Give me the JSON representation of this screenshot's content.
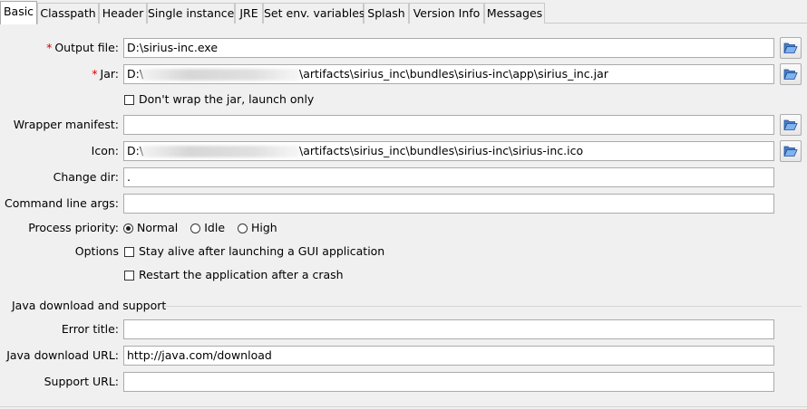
{
  "tabs": [
    {
      "label": "Basic"
    },
    {
      "label": "Classpath"
    },
    {
      "label": "Header"
    },
    {
      "label": "Single instance"
    },
    {
      "label": "JRE"
    },
    {
      "label": "Set env. variables"
    },
    {
      "label": "Splash"
    },
    {
      "label": "Version Info"
    },
    {
      "label": "Messages"
    }
  ],
  "form": {
    "output_file": {
      "label": "Output file:",
      "required_mark": "*",
      "value": "D:\\sirius-inc.exe"
    },
    "jar": {
      "label": "Jar:",
      "required_mark": "*",
      "value_prefix": "D:\\",
      "value_suffix": "\\artifacts\\sirius_inc\\bundles\\sirius-inc\\app\\sirius_inc.jar"
    },
    "dont_wrap": {
      "label": "Don't wrap the jar, launch only",
      "checked": false
    },
    "wrapper_manifest": {
      "label": "Wrapper manifest:",
      "value": ""
    },
    "icon": {
      "label": "Icon:",
      "value_prefix": "D:\\",
      "value_suffix": "\\artifacts\\sirius_inc\\bundles\\sirius-inc\\sirius-inc.ico"
    },
    "change_dir": {
      "label": "Change dir:",
      "value": "."
    },
    "command_line_args": {
      "label": "Command line args:",
      "value": ""
    },
    "process_priority": {
      "label": "Process priority:",
      "options": [
        "Normal",
        "Idle",
        "High"
      ],
      "selected": "Normal"
    },
    "options": {
      "label": "Options",
      "stay_alive": {
        "label": "Stay alive after launching a GUI application",
        "checked": false
      },
      "restart": {
        "label": "Restart the application after a crash",
        "checked": false
      }
    }
  },
  "java_download": {
    "section_title": "Java download and support",
    "error_title": {
      "label": "Error title:",
      "value": ""
    },
    "download_url": {
      "label": "Java download URL:",
      "value": "http://java.com/download"
    },
    "support_url": {
      "label": "Support URL:",
      "value": ""
    }
  },
  "icons": {
    "browse": "folder-open-icon"
  }
}
